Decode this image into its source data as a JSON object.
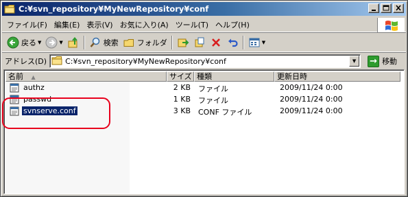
{
  "window": {
    "title": "C:¥svn_repository¥MyNewRepository¥conf"
  },
  "menu": {
    "items": [
      {
        "label": "ファイル(F)"
      },
      {
        "label": "編集(E)"
      },
      {
        "label": "表示(V)"
      },
      {
        "label": "お気に入り(A)"
      },
      {
        "label": "ツール(T)"
      },
      {
        "label": "ヘルプ(H)"
      }
    ]
  },
  "toolbar": {
    "back_label": "戻る",
    "search_label": "検索",
    "folders_label": "フォルダ"
  },
  "address": {
    "label": "アドレス(D)",
    "value": "C:¥svn_repository¥MyNewRepository¥conf",
    "go_label": "移動"
  },
  "list": {
    "columns": [
      {
        "label": "名前"
      },
      {
        "label": "サイズ"
      },
      {
        "label": "種類"
      },
      {
        "label": "更新日時"
      }
    ],
    "rows": [
      {
        "name": "authz",
        "size": "2 KB",
        "type": "ファイル",
        "modified": "2009/11/24 0:00"
      },
      {
        "name": "passwd",
        "size": "1 KB",
        "type": "ファイル",
        "modified": "2009/11/24 0:00"
      },
      {
        "name": "svnserve.conf",
        "size": "3 KB",
        "type": "CONF ファイル",
        "modified": "2009/11/24 0:00"
      }
    ],
    "selected_row": "svnserve.conf"
  },
  "colors": {
    "titlebar_start": "#0a246a",
    "titlebar_end": "#a6caf0",
    "selection": "#0a246a",
    "annotation": "#e8001c"
  }
}
